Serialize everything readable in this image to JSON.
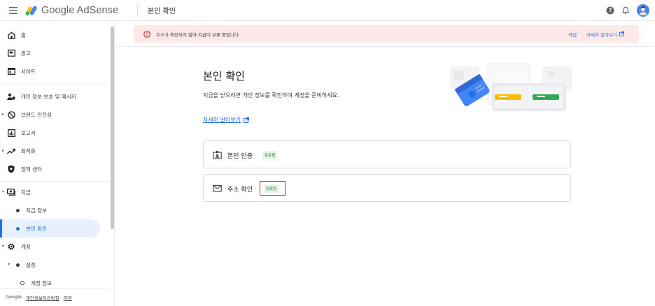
{
  "app": {
    "brand": "Google AdSense",
    "page_heading": "본인 확인"
  },
  "sidebar": {
    "items": [
      {
        "label": "홈",
        "icon": "home-icon"
      },
      {
        "label": "광고",
        "icon": "ads-icon"
      },
      {
        "label": "사이트",
        "icon": "sites-icon"
      },
      {
        "label": "개인 정보 보호 및 메시지",
        "icon": "privacy-messaging-icon"
      },
      {
        "label": "브랜드 안전성",
        "icon": "block-icon"
      },
      {
        "label": "보고서",
        "icon": "reports-icon"
      },
      {
        "label": "최적화",
        "icon": "trending-up-icon"
      },
      {
        "label": "정책 센터",
        "icon": "policy-shield-icon"
      },
      {
        "label": "지급",
        "icon": "payments-icon"
      },
      {
        "label": "지급 정보",
        "icon": "dot-icon"
      },
      {
        "label": "본인 확인",
        "icon": "dot-icon"
      },
      {
        "label": "계정",
        "icon": "settings-gear-icon"
      },
      {
        "label": "설정",
        "icon": "dot-icon"
      },
      {
        "label": "계정 정보",
        "icon": "ring-icon"
      }
    ],
    "footer": {
      "google": "Google",
      "privacy": "개인정보처리방침",
      "terms": "약관"
    }
  },
  "alert": {
    "text": "주소가 확인되지 않아 지급이 보류 중입니다",
    "action": "작업",
    "learn_more": "자세히 알아보기"
  },
  "main": {
    "title": "본인 확인",
    "description": "지급을 받으려면 개인 정보를 확인하여 계정을 준비하세요.",
    "learn_more": "자세히 알아보기",
    "cards": [
      {
        "label": "본인 인증",
        "status": "완료됨"
      },
      {
        "label": "주소 확인",
        "status": "완료됨"
      }
    ]
  },
  "colors": {
    "accent": "#1a73e8",
    "alert_bg": "#fce8e6",
    "success": "#137333",
    "highlight": "#d93025"
  }
}
